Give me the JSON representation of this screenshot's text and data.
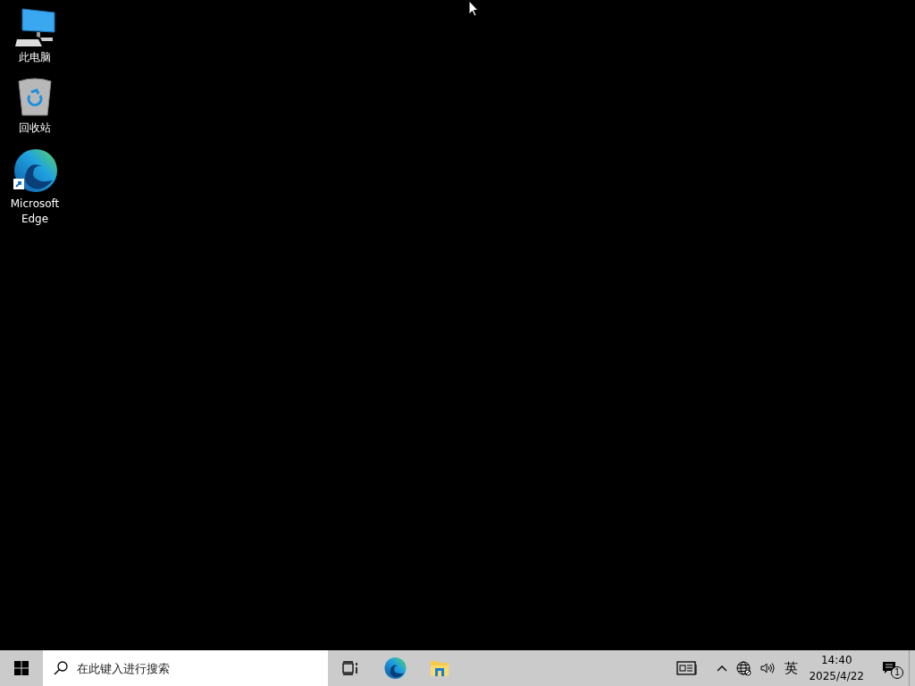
{
  "desktop_icons": [
    {
      "kind": "computer",
      "label": "此电脑"
    },
    {
      "kind": "recycle",
      "label": "回收站"
    },
    {
      "kind": "edge",
      "label": "Microsoft Edge",
      "shortcut": true
    }
  ],
  "taskbar": {
    "search": {
      "placeholder": "在此键入进行搜索"
    },
    "pinned": [
      {
        "kind": "taskview"
      },
      {
        "kind": "edge"
      },
      {
        "kind": "explorer"
      }
    ],
    "tray": {
      "input_method": "英",
      "time": "14:40",
      "date": "2025/4/22",
      "notification_count": "1"
    }
  }
}
